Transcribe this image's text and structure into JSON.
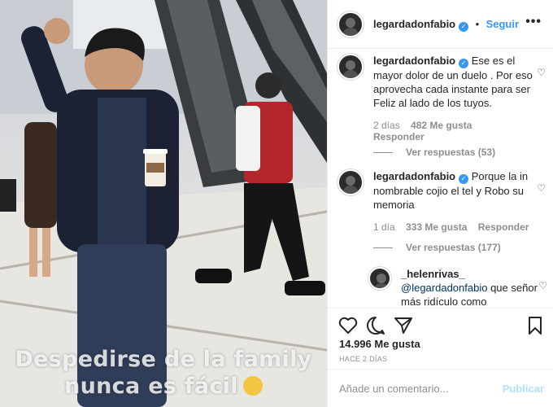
{
  "media": {
    "caption_line1": "Despedirse de la family",
    "caption_line2": "nunca es fácil"
  },
  "header": {
    "username": "legardadonfabio",
    "separator": "•",
    "follow_label": "Seguir",
    "more_label": "•••"
  },
  "comments": [
    {
      "username": "legardadonfabio",
      "text": "Ese es el mayor dolor de un duelo . Por eso aprovecha cada instante para ser Feliz al lado de los tuyos.",
      "time": "2 días",
      "likes": "482 Me gusta",
      "reply_label": "Responder",
      "view_replies": "Ver respuestas (53)"
    },
    {
      "username": "legardadonfabio",
      "text": "Porque la in nombrable cojio el tel y Robo su memoria",
      "time": "1 día",
      "likes": "333 Me gusta",
      "reply_label": "Responder",
      "view_replies": "Ver respuestas (177)"
    },
    {
      "username": "_helenrivas_",
      "mention": "@legardadonfabio",
      "text": "que señor más ridículo como"
    }
  ],
  "actions": {
    "likes": "14.996 Me gusta",
    "posted": "HACE 2 DÍAS"
  },
  "add_comment": {
    "placeholder": "Añade un comentario...",
    "publish_label": "Publicar"
  },
  "colors": {
    "accent": "#3897f0",
    "muted": "#8e8e8e",
    "border": "#efefef"
  }
}
